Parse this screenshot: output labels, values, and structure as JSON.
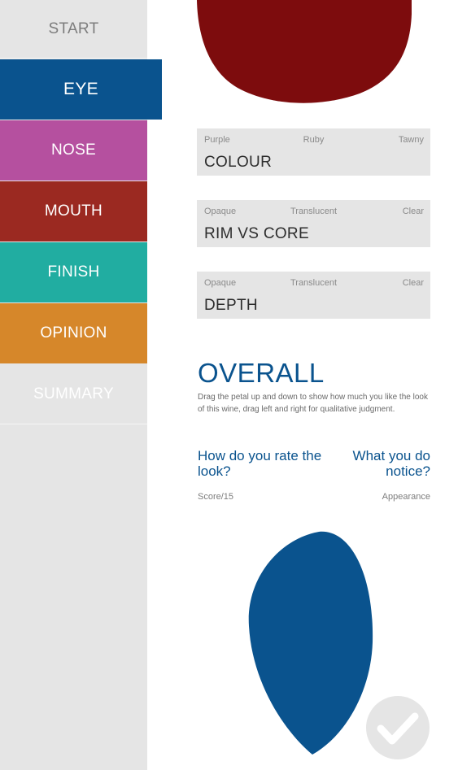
{
  "nav": {
    "start": "START",
    "eye": "EYE",
    "nose": "NOSE",
    "mouth": "MOUTH",
    "finish": "FINISH",
    "opinion": "OPINION",
    "summary": "SUMMARY"
  },
  "colors": {
    "eye": "#0a538e",
    "nose": "#b5509f",
    "mouth": "#9b2921",
    "finish": "#21ada1",
    "opinion": "#d6872a",
    "wine": "#7d0c0d",
    "card": "#e5e5e5"
  },
  "cards": [
    {
      "title": "COLOUR",
      "scale": [
        "Purple",
        "Ruby",
        "Tawny"
      ]
    },
    {
      "title": "RIM VS CORE",
      "scale": [
        "Opaque",
        "Translucent",
        "Clear"
      ]
    },
    {
      "title": "DEPTH",
      "scale": [
        "Opaque",
        "Translucent",
        "Clear"
      ]
    }
  ],
  "overall": {
    "title": "OVERALL",
    "description": "Drag the petal up and down to show how much you like the look of this wine, drag left and right for qualitative judgment.",
    "question_left": "How do you rate the look?",
    "question_right": "What you do notice?",
    "score_label": "Score/15",
    "appearance_label": "Appearance"
  },
  "icons": {
    "confirm": "checkmark-icon"
  }
}
